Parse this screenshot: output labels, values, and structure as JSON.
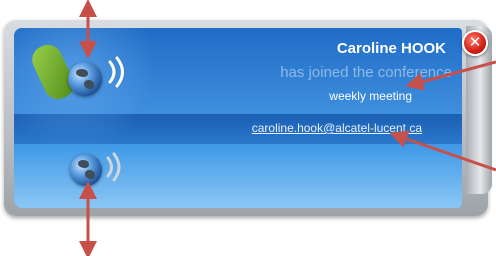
{
  "notification": {
    "caller_name": "Caroline HOOK",
    "status": "has joined the conference",
    "conference_name": "weekly meeting",
    "email": "caroline.hook@alcatel-lucent.ca"
  },
  "icons": {
    "call": "phone-globe-icon",
    "close": "close-icon",
    "presence": "globe-icon"
  },
  "colors": {
    "panel_blue": "#2e7fd2",
    "band_blue": "#1a5fb2",
    "close_red": "#d11f14",
    "annotation_arrow": "#c8504a"
  }
}
